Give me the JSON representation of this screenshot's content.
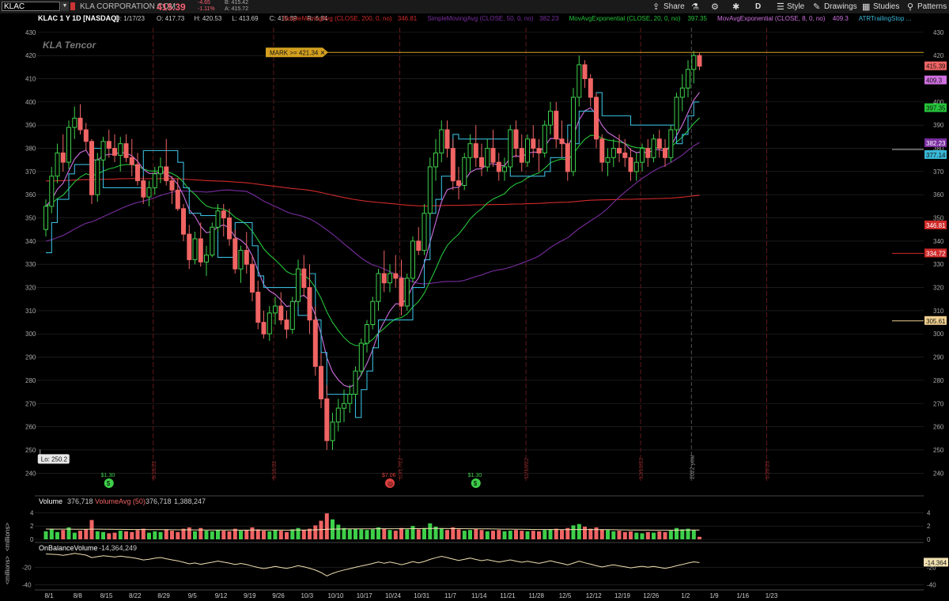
{
  "header": {
    "symbol": "KLAC",
    "company": "KLA CORPORATION COM",
    "last": "415.39",
    "change": "-4.65",
    "change_pct": "-1.11%",
    "bid": "B: 415.42",
    "ask": "A: 415.72",
    "toolbar": {
      "share": "Share",
      "timeframe": "D",
      "style": "Style",
      "drawings": "Drawings",
      "studies": "Studies",
      "patterns": "Patterns"
    }
  },
  "colors": {
    "up": "#3ecf4a",
    "down": "#f06464",
    "sma200": "#d02a2a",
    "sma50": "#7a2da0",
    "ema20": "#25c43a",
    "ema8": "#d070e0",
    "atr": "#38b8d8",
    "mark": "#d4a020",
    "grid": "#2a2a2a",
    "bg": "#000000"
  },
  "chart_data": {
    "type": "candlestick",
    "legend": {
      "title": "KLAC 1 Y 1D [NASDAQ]",
      "ohlc": [
        "D: 1/17/23",
        "O: 417.73",
        "H: 420.53",
        "L: 413.69",
        "C: 415.39",
        "R: 6.84"
      ],
      "studies": [
        {
          "label": "SimpleMovingAvg (CLOSE, 200, 0, no)",
          "value": "346.81",
          "color": "#d02a2a"
        },
        {
          "label": "SimpleMovingAvg (CLOSE, 50, 0, no)",
          "value": "382.23",
          "color": "#7a2da0"
        },
        {
          "label": "MovAvgExponential (CLOSE, 20, 0, no)",
          "value": "397.35",
          "color": "#25c43a"
        },
        {
          "label": "MovAvgExponential (CLOSE, 8, 0, no)",
          "value": "409.3",
          "color": "#d070e0"
        },
        {
          "label": "ATRTrailingStop ...",
          "value": "",
          "color": "#38b8d8"
        }
      ]
    },
    "logo": "KLA Tencor",
    "y_ticks": [
      240,
      250,
      260,
      270,
      280,
      290,
      300,
      310,
      320,
      330,
      340,
      350,
      360,
      370,
      380,
      390,
      400,
      410,
      420,
      430
    ],
    "y_range": [
      236,
      432
    ],
    "x_ticks": [
      "8/1",
      "8/8",
      "8/15",
      "8/22",
      "8/29",
      "9/5",
      "9/12",
      "9/19",
      "9/26",
      "10/3",
      "10/10",
      "10/17",
      "10/24",
      "10/31",
      "11/7",
      "11/14",
      "11/21",
      "11/28",
      "12/5",
      "12/12",
      "12/19",
      "12/26",
      "1/2",
      "1/9",
      "1/16",
      "1/23"
    ],
    "month_markers": [
      "8/18/22",
      "9/16/22",
      "10/17/22",
      "11/18/22",
      "12/16/22",
      "1/20/23"
    ],
    "year_marker": "2022 year",
    "mark_label": "MARK >= 421.34",
    "mark_level": 421.34,
    "lo_label": "Lo: 250.2",
    "lo_value": 250.2,
    "price_tags": [
      {
        "value": "415.39",
        "price": 415.39,
        "color": "#f06464",
        "text": "#111"
      },
      {
        "value": "409.3",
        "price": 409.3,
        "color": "#d070e0",
        "text": "#111"
      },
      {
        "value": "397.35",
        "price": 397.35,
        "color": "#25c43a",
        "text": "#111"
      },
      {
        "value": "382.23",
        "price": 382.23,
        "color": "#7a2da0",
        "text": "#fff"
      },
      {
        "value": "377.14",
        "price": 377.14,
        "color": "#38b8d8",
        "text": "#111"
      },
      {
        "value": "346.81",
        "price": 346.81,
        "color": "#d02a2a",
        "text": "#fff"
      },
      {
        "value": "334.72",
        "price": 334.72,
        "color": "#d02a2a",
        "text": "#fff"
      },
      {
        "value": "305.61",
        "price": 305.61,
        "color": "#f0d090",
        "text": "#111"
      }
    ],
    "right_lines": [
      {
        "price": 379.5,
        "color": "#bbbbbb"
      },
      {
        "price": 334.72,
        "color": "#d02a2a"
      },
      {
        "price": 305.61,
        "color": "#f0d090"
      }
    ],
    "events": [
      {
        "label": "$1.30",
        "x": "8/15",
        "idx": 11,
        "color": "#3ecf4a"
      },
      {
        "label": "$7.06",
        "x": "10/24",
        "idx": 60,
        "color": "#e04040"
      },
      {
        "label": "$1.30",
        "x": "11/14",
        "idx": 75,
        "color": "#3ecf4a"
      }
    ],
    "candles": [
      [
        345,
        358,
        342,
        355
      ],
      [
        355,
        372,
        352,
        368
      ],
      [
        368,
        382,
        365,
        378
      ],
      [
        378,
        386,
        370,
        374
      ],
      [
        374,
        392,
        371,
        389
      ],
      [
        389,
        398,
        384,
        393
      ],
      [
        393,
        399,
        386,
        388
      ],
      [
        388,
        391,
        379,
        383
      ],
      [
        383,
        384,
        356,
        360
      ],
      [
        360,
        378,
        357,
        375
      ],
      [
        375,
        385,
        372,
        383
      ],
      [
        383,
        388,
        376,
        380
      ],
      [
        380,
        386,
        374,
        377
      ],
      [
        377,
        385,
        370,
        382
      ],
      [
        382,
        386,
        374,
        376
      ],
      [
        376,
        384,
        368,
        373
      ],
      [
        373,
        378,
        364,
        366
      ],
      [
        366,
        368,
        356,
        359
      ],
      [
        359,
        366,
        355,
        363
      ],
      [
        363,
        372,
        360,
        369
      ],
      [
        369,
        376,
        365,
        372
      ],
      [
        372,
        384,
        364,
        366
      ],
      [
        366,
        368,
        356,
        362
      ],
      [
        362,
        367,
        353,
        354
      ],
      [
        354,
        356,
        340,
        343
      ],
      [
        343,
        347,
        328,
        332
      ],
      [
        332,
        344,
        330,
        341
      ],
      [
        341,
        348,
        329,
        331
      ],
      [
        331,
        338,
        325,
        334
      ],
      [
        334,
        348,
        333,
        346
      ],
      [
        346,
        356,
        344,
        353
      ],
      [
        353,
        356,
        342,
        350
      ],
      [
        350,
        354,
        338,
        341
      ],
      [
        341,
        345,
        326,
        328
      ],
      [
        328,
        338,
        322,
        336
      ],
      [
        336,
        344,
        326,
        330
      ],
      [
        330,
        334,
        314,
        318
      ],
      [
        318,
        323,
        302,
        305
      ],
      [
        305,
        310,
        298,
        300
      ],
      [
        300,
        312,
        297,
        309
      ],
      [
        309,
        316,
        304,
        312
      ],
      [
        312,
        318,
        304,
        306
      ],
      [
        306,
        310,
        298,
        302
      ],
      [
        302,
        316,
        300,
        314
      ],
      [
        314,
        332,
        312,
        328
      ],
      [
        328,
        334,
        316,
        320
      ],
      [
        320,
        330,
        300,
        306
      ],
      [
        306,
        312,
        282,
        286
      ],
      [
        286,
        292,
        268,
        272
      ],
      [
        272,
        278,
        250,
        254
      ],
      [
        254,
        266,
        250,
        262
      ],
      [
        262,
        272,
        258,
        268
      ],
      [
        268,
        276,
        262,
        270
      ],
      [
        270,
        278,
        266,
        274
      ],
      [
        274,
        286,
        272,
        284
      ],
      [
        284,
        298,
        282,
        296
      ],
      [
        296,
        306,
        292,
        304
      ],
      [
        304,
        316,
        302,
        314
      ],
      [
        314,
        328,
        310,
        326
      ],
      [
        326,
        336,
        318,
        322
      ],
      [
        322,
        330,
        318,
        326
      ],
      [
        326,
        334,
        320,
        324
      ],
      [
        324,
        332,
        308,
        312
      ],
      [
        312,
        326,
        310,
        324
      ],
      [
        324,
        342,
        322,
        340
      ],
      [
        340,
        346,
        334,
        336
      ],
      [
        336,
        356,
        334,
        352
      ],
      [
        352,
        376,
        350,
        372
      ],
      [
        372,
        384,
        366,
        378
      ],
      [
        378,
        392,
        374,
        388
      ],
      [
        388,
        392,
        376,
        380
      ],
      [
        380,
        384,
        362,
        366
      ],
      [
        366,
        372,
        358,
        364
      ],
      [
        364,
        378,
        362,
        376
      ],
      [
        376,
        386,
        370,
        382
      ],
      [
        382,
        390,
        372,
        376
      ],
      [
        376,
        382,
        368,
        372
      ],
      [
        372,
        384,
        370,
        380
      ],
      [
        380,
        388,
        372,
        374
      ],
      [
        374,
        378,
        366,
        370
      ],
      [
        370,
        376,
        366,
        372
      ],
      [
        372,
        390,
        370,
        388
      ],
      [
        388,
        392,
        376,
        380
      ],
      [
        380,
        386,
        370,
        374
      ],
      [
        374,
        386,
        372,
        384
      ],
      [
        384,
        390,
        376,
        380
      ],
      [
        380,
        384,
        370,
        378
      ],
      [
        378,
        392,
        376,
        390
      ],
      [
        390,
        400,
        386,
        396
      ],
      [
        396,
        400,
        380,
        384
      ],
      [
        384,
        392,
        376,
        382
      ],
      [
        382,
        384,
        366,
        370
      ],
      [
        370,
        406,
        368,
        402
      ],
      [
        402,
        420,
        398,
        416
      ],
      [
        416,
        418,
        406,
        410
      ],
      [
        410,
        412,
        398,
        402
      ],
      [
        402,
        404,
        380,
        384
      ],
      [
        384,
        386,
        370,
        374
      ],
      [
        374,
        380,
        368,
        376
      ],
      [
        376,
        384,
        372,
        380
      ],
      [
        380,
        386,
        374,
        378
      ],
      [
        378,
        384,
        372,
        376
      ],
      [
        376,
        380,
        366,
        370
      ],
      [
        370,
        378,
        366,
        374
      ],
      [
        374,
        382,
        370,
        380
      ],
      [
        380,
        384,
        372,
        376
      ],
      [
        376,
        386,
        374,
        384
      ],
      [
        384,
        388,
        376,
        380
      ],
      [
        380,
        384,
        372,
        376
      ],
      [
        376,
        390,
        374,
        388
      ],
      [
        388,
        404,
        386,
        402
      ],
      [
        402,
        412,
        396,
        406
      ],
      [
        406,
        418,
        402,
        414
      ],
      [
        414,
        422,
        408,
        420
      ],
      [
        420,
        421,
        413.69,
        415.39
      ]
    ],
    "volume": {
      "label": "Volume",
      "value": "376,718",
      "avg_label": "VolumeAvg (50)",
      "avg_value": "376,718",
      "avg2_value": "1,388,247",
      "y_ticks": [
        0,
        2,
        4
      ],
      "y_range": [
        0,
        5
      ],
      "unit_label": "<millions>"
    },
    "volume_values": [
      1.2,
      1.6,
      1.1,
      1.4,
      1.8,
      1.0,
      1.3,
      1.5,
      2.9,
      1.2,
      1.1,
      0.9,
      1.0,
      1.3,
      1.2,
      1.1,
      1.4,
      1.6,
      1.0,
      1.2,
      1.1,
      1.5,
      1.3,
      1.1,
      1.6,
      1.8,
      1.2,
      1.7,
      1.3,
      1.2,
      1.4,
      1.3,
      1.2,
      1.6,
      1.3,
      1.4,
      1.8,
      1.5,
      1.3,
      1.2,
      1.4,
      1.3,
      1.1,
      1.5,
      1.7,
      1.4,
      1.6,
      2.1,
      2.8,
      3.9,
      3.0,
      2.2,
      1.7,
      1.5,
      1.6,
      1.5,
      1.4,
      1.5,
      1.8,
      1.6,
      1.4,
      1.3,
      1.7,
      1.5,
      2.0,
      1.5,
      1.7,
      2.4,
      1.9,
      1.6,
      1.4,
      1.8,
      1.5,
      1.3,
      1.4,
      1.6,
      1.4,
      1.2,
      1.3,
      1.4,
      1.2,
      1.3,
      1.4,
      1.3,
      1.2,
      1.3,
      1.2,
      1.4,
      1.5,
      1.6,
      1.4,
      1.7,
      2.1,
      2.3,
      1.9,
      1.6,
      1.8,
      1.5,
      1.4,
      1.2,
      1.3,
      1.1,
      1.2,
      1.0,
      0.9,
      1.1,
      1.0,
      1.2,
      1.1,
      1.3,
      1.7,
      1.5,
      1.6,
      1.4,
      0.38
    ],
    "volume_avg": [
      1.55,
      1.54,
      1.54,
      1.53,
      1.53,
      1.52,
      1.52,
      1.52,
      1.53,
      1.53,
      1.52,
      1.51,
      1.5,
      1.5,
      1.49,
      1.48,
      1.48,
      1.48,
      1.47,
      1.46,
      1.45,
      1.45,
      1.44,
      1.43,
      1.43,
      1.43,
      1.42,
      1.42,
      1.41,
      1.4,
      1.4,
      1.39,
      1.39,
      1.39,
      1.38,
      1.38,
      1.39,
      1.39,
      1.39,
      1.39,
      1.39,
      1.39,
      1.38,
      1.39,
      1.4,
      1.4,
      1.41,
      1.43,
      1.46,
      1.51,
      1.54,
      1.55,
      1.56,
      1.57,
      1.57,
      1.58,
      1.58,
      1.58,
      1.59,
      1.59,
      1.59,
      1.59,
      1.59,
      1.6,
      1.61,
      1.61,
      1.62,
      1.63,
      1.63,
      1.63,
      1.62,
      1.62,
      1.61,
      1.6,
      1.59,
      1.58,
      1.58,
      1.57,
      1.56,
      1.55,
      1.54,
      1.53,
      1.52,
      1.51,
      1.5,
      1.49,
      1.48,
      1.48,
      1.48,
      1.48,
      1.47,
      1.47,
      1.48,
      1.48,
      1.48,
      1.48,
      1.47,
      1.46,
      1.45,
      1.44,
      1.43,
      1.42,
      1.41,
      1.4,
      1.39,
      1.39,
      1.38,
      1.38,
      1.38,
      1.38,
      1.38,
      1.39,
      1.39,
      1.39,
      1.39
    ],
    "obv": {
      "label": "OnBalanceVolume",
      "value": "-14,364,249",
      "tag": "-14.364",
      "y_ticks": [
        -20,
        -40
      ],
      "y_range": [
        -44,
        -4
      ],
      "unit_label": "<millions>"
    },
    "obv_values": [
      -4.5,
      -4.8,
      -5.2,
      -6.0,
      -5.0,
      -3.8,
      -4.6,
      -5.8,
      -8.6,
      -7.5,
      -6.5,
      -7.2,
      -8.0,
      -7.0,
      -7.8,
      -8.6,
      -9.8,
      -11.4,
      -10.6,
      -9.4,
      -8.5,
      -10.0,
      -11.3,
      -12.4,
      -14.0,
      -15.8,
      -14.8,
      -16.4,
      -15.1,
      -14.0,
      -12.6,
      -13.9,
      -15.0,
      -16.6,
      -15.4,
      -16.6,
      -18.4,
      -20.0,
      -21.3,
      -20.1,
      -18.7,
      -20.0,
      -21.1,
      -19.6,
      -17.9,
      -19.3,
      -20.9,
      -23.0,
      -25.8,
      -29.7,
      -26.8,
      -24.6,
      -22.9,
      -21.4,
      -19.8,
      -18.3,
      -16.9,
      -15.4,
      -13.6,
      -15.2,
      -13.8,
      -15.1,
      -16.8,
      -15.3,
      -13.3,
      -14.8,
      -13.1,
      -10.7,
      -8.8,
      -7.2,
      -8.6,
      -10.4,
      -11.9,
      -10.6,
      -9.2,
      -10.8,
      -12.2,
      -11.0,
      -12.4,
      -13.8,
      -12.6,
      -11.3,
      -12.7,
      -14.0,
      -12.8,
      -14.1,
      -15.3,
      -13.9,
      -12.4,
      -14.0,
      -15.4,
      -17.1,
      -15.0,
      -12.7,
      -14.6,
      -16.2,
      -18.0,
      -19.5,
      -18.1,
      -16.9,
      -18.2,
      -19.3,
      -20.5,
      -19.5,
      -18.6,
      -19.7,
      -18.7,
      -19.9,
      -21.0,
      -19.7,
      -18.0,
      -16.5,
      -14.9,
      -13.5,
      -14.4
    ]
  }
}
